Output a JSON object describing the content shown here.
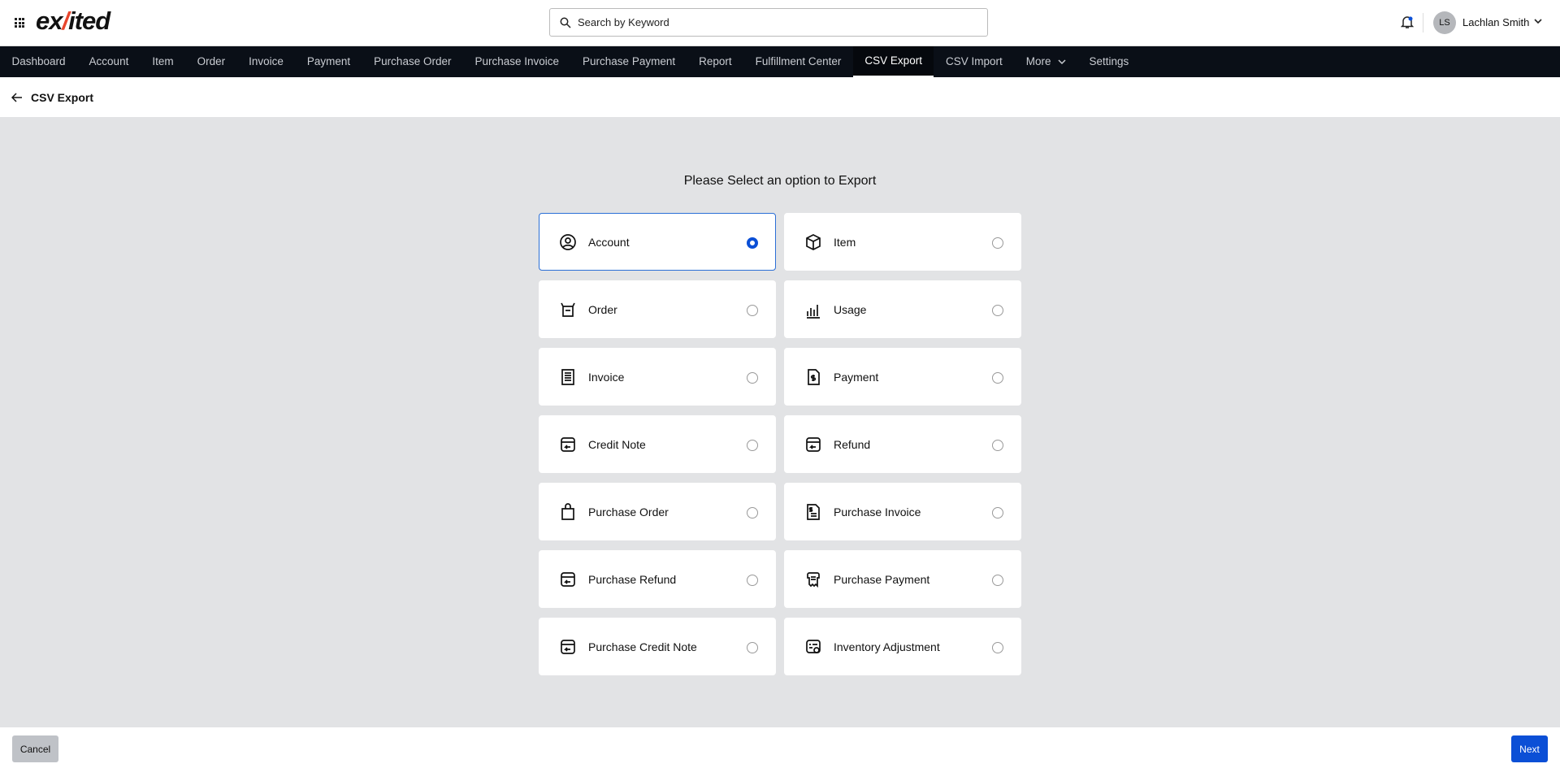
{
  "header": {
    "logo": "exsited",
    "search_placeholder": "Search by Keyword",
    "user_initials": "LS",
    "user_name": "Lachlan Smith"
  },
  "nav": [
    "Dashboard",
    "Account",
    "Item",
    "Order",
    "Invoice",
    "Payment",
    "Purchase Order",
    "Purchase Invoice",
    "Purchase Payment",
    "Report",
    "Fulfillment Center",
    "CSV Export",
    "CSV Import",
    "More",
    "Settings"
  ],
  "nav_active": "CSV Export",
  "breadcrumb": "CSV Export",
  "prompt": "Please Select an option to Export",
  "options": [
    {
      "label": "Account",
      "icon": "account-icon",
      "selected": true
    },
    {
      "label": "Item",
      "icon": "box-icon",
      "selected": false
    },
    {
      "label": "Order",
      "icon": "order-icon",
      "selected": false
    },
    {
      "label": "Usage",
      "icon": "bar-chart-icon",
      "selected": false
    },
    {
      "label": "Invoice",
      "icon": "invoice-icon",
      "selected": false
    },
    {
      "label": "Payment",
      "icon": "payment-icon",
      "selected": false
    },
    {
      "label": "Credit Note",
      "icon": "credit-note-icon",
      "selected": false
    },
    {
      "label": "Refund",
      "icon": "refund-icon",
      "selected": false
    },
    {
      "label": "Purchase Order",
      "icon": "shopping-bag-icon",
      "selected": false
    },
    {
      "label": "Purchase Invoice",
      "icon": "purchase-invoice-icon",
      "selected": false
    },
    {
      "label": "Purchase Refund",
      "icon": "purchase-refund-icon",
      "selected": false
    },
    {
      "label": "Purchase Payment",
      "icon": "purchase-payment-icon",
      "selected": false
    },
    {
      "label": "Purchase Credit Note",
      "icon": "purchase-credit-note-icon",
      "selected": false
    },
    {
      "label": "Inventory Adjustment",
      "icon": "inventory-adjustment-icon",
      "selected": false
    }
  ],
  "footer": {
    "cancel": "Cancel",
    "next": "Next"
  },
  "colors": {
    "accent": "#0b4fd6",
    "nav_bg": "#0a0f17",
    "page_bg": "#e2e3e5"
  }
}
